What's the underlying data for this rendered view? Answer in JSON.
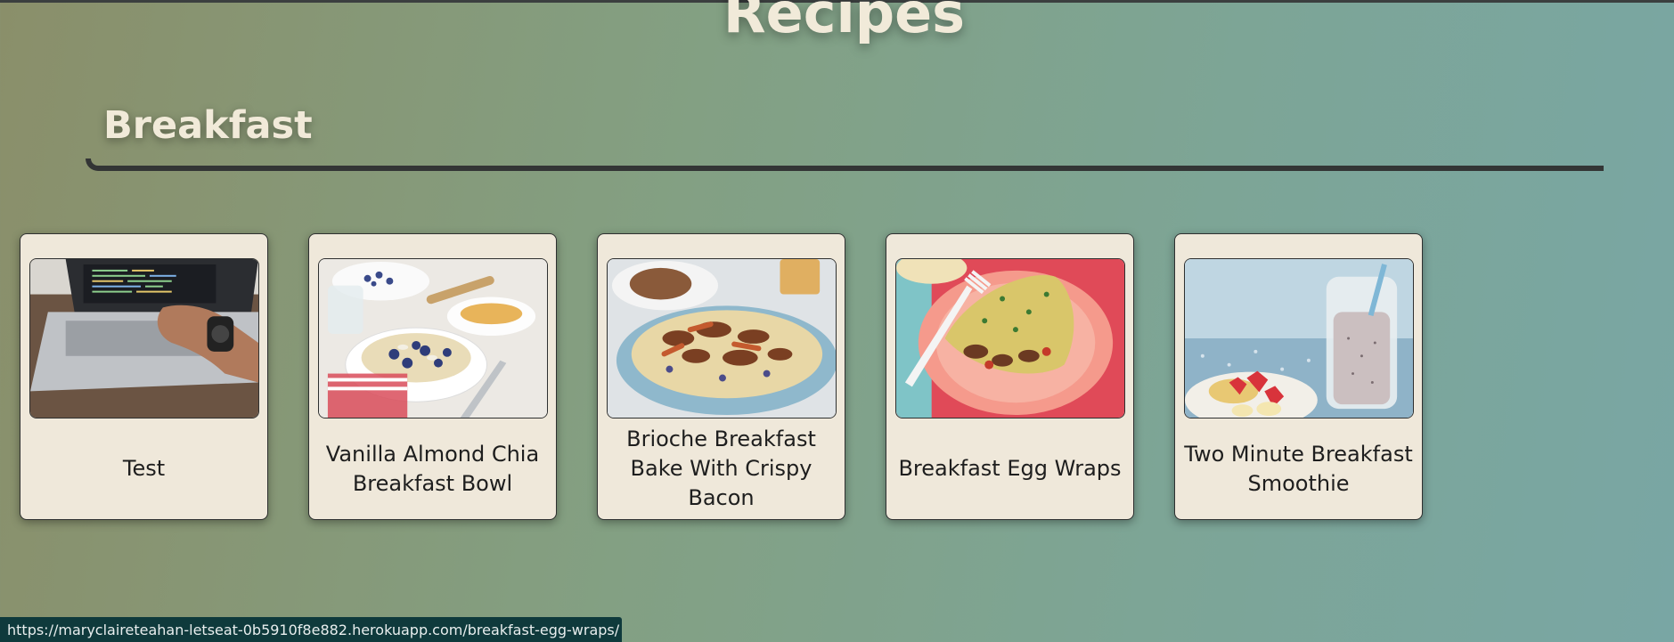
{
  "page": {
    "title": "Recipes"
  },
  "section": {
    "title": "Breakfast"
  },
  "cards": [
    {
      "title": "Test",
      "image_icon": "laptop-typing-photo"
    },
    {
      "title": "Vanilla Almond Chia Breakfast Bowl",
      "image_icon": "chia-bowl-photo"
    },
    {
      "title": "Brioche Breakfast Bake With Crispy Bacon",
      "image_icon": "brioche-bake-photo"
    },
    {
      "title": "Breakfast Egg Wraps",
      "image_icon": "egg-wrap-photo"
    },
    {
      "title": "Two Minute Breakfast Smoothie",
      "image_icon": "smoothie-photo"
    }
  ],
  "status_bar": {
    "url": "https://maryclaireteahan-letseat-0b5910f8e882.herokuapp.com/breakfast-egg-wraps/"
  },
  "colors": {
    "heading": "#f1ead9",
    "card_bg": "#efe8da",
    "rule": "#333535",
    "status_bg": "#0f3a3c"
  }
}
